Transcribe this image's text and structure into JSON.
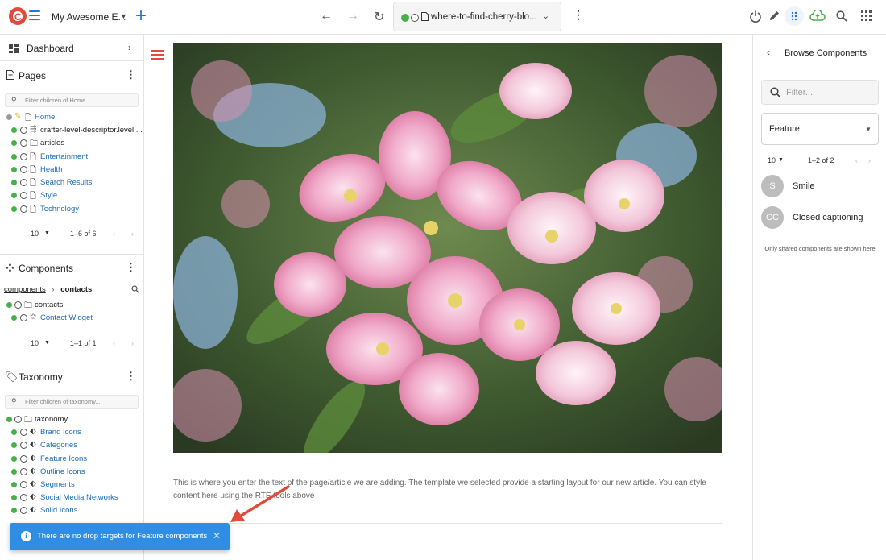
{
  "topbar": {
    "site_name": "My Awesome E...",
    "url_text": "where-to-find-cherry-blo...",
    "icons": [
      "crafter-logo-icon",
      "menu-icon",
      "chevron-down-icon",
      "plus-icon",
      "back-arrow-icon",
      "forward-arrow-icon",
      "refresh-icon",
      "page-icon",
      "chevron-down-icon",
      "more-vert-icon",
      "power-icon",
      "pencil-icon",
      "drag-dots-icon",
      "cloud-upload-icon",
      "search-icon",
      "apps-grid-icon"
    ]
  },
  "sidebar": {
    "dashboard_label": "Dashboard",
    "pages": {
      "title": "Pages",
      "filter_placeholder": "Filter children of Home...",
      "items": [
        {
          "label": "Home"
        },
        {
          "label": "crafter-level-descriptor.level...."
        },
        {
          "label": "articles"
        },
        {
          "label": "Entertainment"
        },
        {
          "label": "Health"
        },
        {
          "label": "Search Results"
        },
        {
          "label": "Style"
        },
        {
          "label": "Technology"
        }
      ],
      "per_page": "10",
      "range": "1–6 of 6"
    },
    "components": {
      "title": "Components",
      "breadcrumb_root": "components",
      "breadcrumb_current": "contacts",
      "items": [
        {
          "label": "contacts"
        },
        {
          "label": "Contact Widget"
        }
      ],
      "per_page": "10",
      "range": "1–1 of 1"
    },
    "taxonomy": {
      "title": "Taxonomy",
      "filter_placeholder": "Filter children of taxonomy...",
      "items": [
        {
          "label": "taxonomy"
        },
        {
          "label": "Brand Icons"
        },
        {
          "label": "Categories"
        },
        {
          "label": "Feature Icons"
        },
        {
          "label": "Outline Icons"
        },
        {
          "label": "Segments"
        },
        {
          "label": "Social Media Networks"
        },
        {
          "label": "Solid Icons"
        }
      ]
    }
  },
  "main": {
    "body_text": "This is where you enter the text of the page/article we are adding.  The template we selected provide a starting layout for our new article.  You can style content here using the RTE tools above"
  },
  "right_panel": {
    "title": "Browse Components",
    "filter_placeholder": "Filter...",
    "type_select": "Feature",
    "per_page": "10",
    "range": "1–2 of 2",
    "components": [
      {
        "avatar": "S",
        "name": "Smile"
      },
      {
        "avatar": "CC",
        "name": "Closed captioning"
      }
    ],
    "note": "Only shared components are shown here"
  },
  "toast": {
    "message": "There are no drop targets for Feature components"
  },
  "colors": {
    "accent": "#2c6fd6",
    "status_green": "#48b04b",
    "toast_blue": "#2f8de4",
    "annotation_red": "#e14b3c",
    "link_blue": "#1e6bb8"
  }
}
